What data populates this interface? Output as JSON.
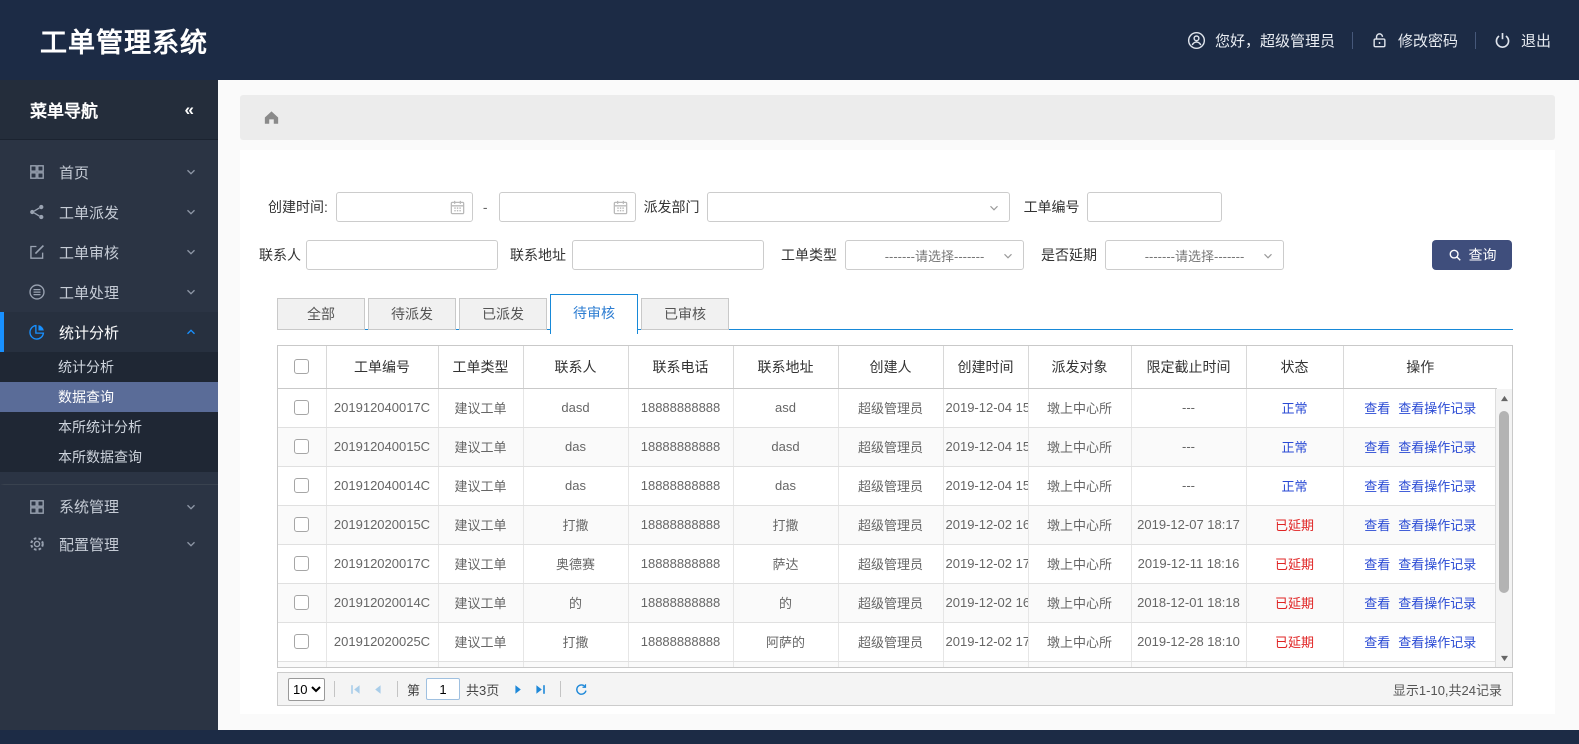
{
  "colors": {
    "navy": "#1c2b45",
    "sidebar": "#2b3444",
    "accent": "#1890ff",
    "tab_blue": "#1789d8",
    "link_blue": "#2a4ad4",
    "danger_red": "#e02424",
    "button_indigo": "#3f4e7c",
    "submenu_selected": "#5a6c98"
  },
  "header": {
    "title": "工单管理系统",
    "greeting": "您好，超级管理员",
    "change_password": "修改密码",
    "logout": "退出"
  },
  "sidebar": {
    "nav_title": "菜单导航",
    "collapse_glyph": "«",
    "items": [
      {
        "label": "首页",
        "icon": "grid",
        "expanded": false
      },
      {
        "label": "工单派发",
        "icon": "share",
        "expanded": false
      },
      {
        "label": "工单审核",
        "icon": "edit",
        "expanded": false
      },
      {
        "label": "工单处理",
        "icon": "database",
        "expanded": false
      },
      {
        "label": "统计分析",
        "icon": "pie",
        "expanded": true,
        "active": true,
        "children": [
          "统计分析",
          "数据查询",
          "本所统计分析",
          "本所数据查询"
        ],
        "selected_child": "数据查询"
      },
      {
        "label": "系统管理",
        "icon": "grid",
        "expanded": false,
        "group2": true
      },
      {
        "label": "配置管理",
        "icon": "gear",
        "expanded": false,
        "group2": true
      }
    ]
  },
  "filters": {
    "create_time_label": "创建时间:",
    "date_from_value": "",
    "date_separator": "-",
    "date_to_value": "",
    "dispatch_dept_label": "派发部门",
    "dispatch_dept_value": "",
    "order_no_label": "工单编号",
    "order_no_value": "",
    "contact_label": "联系人",
    "contact_value": "",
    "address_label": "联系地址",
    "address_value": "",
    "order_type_label": "工单类型",
    "order_type_placeholder": "-------请选择-------",
    "delay_label": "是否延期",
    "delay_placeholder": "-------请选择-------",
    "search_button": "查询"
  },
  "tabs": [
    {
      "label": "全部",
      "active": false
    },
    {
      "label": "待派发",
      "active": false
    },
    {
      "label": "已派发",
      "active": false
    },
    {
      "label": "待审核",
      "active": true
    },
    {
      "label": "已审核",
      "active": false
    }
  ],
  "table": {
    "columns": [
      "工单编号",
      "工单类型",
      "联系人",
      "联系电话",
      "联系地址",
      "创建人",
      "创建时间",
      "派发对象",
      "限定截止时间",
      "状态",
      "操作"
    ],
    "action_view": "查看",
    "action_view_log": "查看操作记录",
    "rows": [
      {
        "order_no": "201912040017C",
        "type": "建议工单",
        "contact": "dasd",
        "phone": "18888888888",
        "address": "asd",
        "creator": "超级管理员",
        "created": "2019-12-04 15",
        "target": "墩上中心所",
        "deadline": "---",
        "status": "正常",
        "status_type": "normal"
      },
      {
        "order_no": "201912040015C",
        "type": "建议工单",
        "contact": "das",
        "phone": "18888888888",
        "address": "dasd",
        "creator": "超级管理员",
        "created": "2019-12-04 15",
        "target": "墩上中心所",
        "deadline": "---",
        "status": "正常",
        "status_type": "normal"
      },
      {
        "order_no": "201912040014C",
        "type": "建议工单",
        "contact": "das",
        "phone": "18888888888",
        "address": "das",
        "creator": "超级管理员",
        "created": "2019-12-04 15",
        "target": "墩上中心所",
        "deadline": "---",
        "status": "正常",
        "status_type": "normal"
      },
      {
        "order_no": "201912020015C",
        "type": "建议工单",
        "contact": "打撒",
        "phone": "18888888888",
        "address": "打撒",
        "creator": "超级管理员",
        "created": "2019-12-02 16",
        "target": "墩上中心所",
        "deadline": "2019-12-07 18:17",
        "status": "已延期",
        "status_type": "delayed"
      },
      {
        "order_no": "201912020017C",
        "type": "建议工单",
        "contact": "奥德赛",
        "phone": "18888888888",
        "address": "萨达",
        "creator": "超级管理员",
        "created": "2019-12-02 17",
        "target": "墩上中心所",
        "deadline": "2019-12-11 18:16",
        "status": "已延期",
        "status_type": "delayed"
      },
      {
        "order_no": "201912020014C",
        "type": "建议工单",
        "contact": "的",
        "phone": "18888888888",
        "address": "的",
        "creator": "超级管理员",
        "created": "2019-12-02 16",
        "target": "墩上中心所",
        "deadline": "2018-12-01 18:18",
        "status": "已延期",
        "status_type": "delayed"
      },
      {
        "order_no": "201912020025C",
        "type": "建议工单",
        "contact": "打撒",
        "phone": "18888888888",
        "address": "阿萨的",
        "creator": "超级管理员",
        "created": "2019-12-02 17",
        "target": "墩上中心所",
        "deadline": "2019-12-28 18:10",
        "status": "已延期",
        "status_type": "delayed"
      },
      {
        "order_no": "",
        "type": "",
        "contact": "",
        "phone": "",
        "address": "",
        "creator": "",
        "created": "",
        "target": "",
        "deadline": "",
        "status": "",
        "status_type": "normal",
        "partial": true
      }
    ]
  },
  "pagination": {
    "page_size": "10",
    "page_prefix": "第",
    "current_page": "1",
    "total_pages_label": "共3页",
    "summary": "显示1-10,共24记录"
  }
}
